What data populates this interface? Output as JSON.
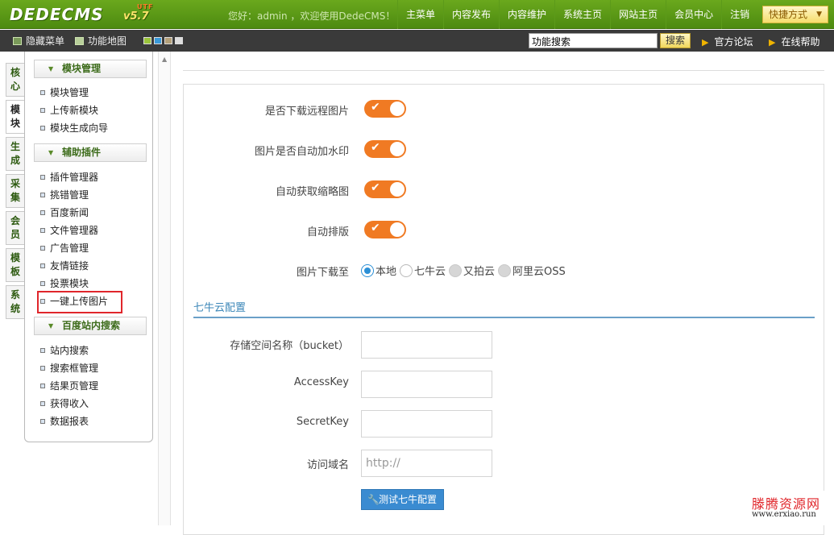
{
  "header": {
    "logo": "DEDECMS",
    "version": "v5.7",
    "charset": "UTF",
    "greeting": "您好：admin ，欢迎使用DedeCMS！",
    "nav": [
      "主菜单",
      "内容发布",
      "内容维护",
      "系统主页",
      "网站主页",
      "会员中心",
      "注销"
    ],
    "quick_menu": "快捷方式",
    "colors": {
      "bar": "#5a9a17",
      "subbar": "#3a3a3a"
    }
  },
  "subbar": {
    "hide_menu": "隐藏菜单",
    "feature_map": "功能地图",
    "skin_colors": [
      "#9ac43c",
      "#3a9ad9",
      "#b3a07a",
      "#dddddd"
    ],
    "search_value": "功能搜索",
    "search_button": "搜索",
    "forum": "官方论坛",
    "help": "在线帮助"
  },
  "vtabs": [
    {
      "label": "核心",
      "active": false
    },
    {
      "label": "模块",
      "active": true
    },
    {
      "label": "生成",
      "active": false
    },
    {
      "label": "采集",
      "active": false
    },
    {
      "label": "会员",
      "active": false
    },
    {
      "label": "模板",
      "active": false
    },
    {
      "label": "系统",
      "active": false
    }
  ],
  "sidebar": {
    "groups": [
      {
        "title": "模块管理",
        "items": [
          "模块管理",
          "上传新模块",
          "模块生成向导"
        ]
      },
      {
        "title": "辅助插件",
        "items": [
          "插件管理器",
          "挑错管理",
          "百度新闻",
          "文件管理器",
          "广告管理",
          "友情链接",
          "投票模块",
          "一键上传图片"
        ]
      },
      {
        "title": "百度站内搜索",
        "items": [
          "站内搜索",
          "搜索框管理",
          "结果页管理",
          "获得收入",
          "数据报表"
        ]
      }
    ],
    "highlighted_item": "一键上传图片"
  },
  "form": {
    "toggles": [
      {
        "label": "是否下载远程图片",
        "on": true
      },
      {
        "label": "图片是否自动加水印",
        "on": true
      },
      {
        "label": "自动获取缩略图",
        "on": true
      },
      {
        "label": "自动排版",
        "on": true
      }
    ],
    "download_to": {
      "label": "图片下载至",
      "options": [
        {
          "label": "本地",
          "checked": true,
          "disabled": false
        },
        {
          "label": "七牛云",
          "checked": false,
          "disabled": false
        },
        {
          "label": "又拍云",
          "checked": false,
          "disabled": true
        },
        {
          "label": "阿里云OSS",
          "checked": false,
          "disabled": true
        }
      ]
    },
    "section_title": "七牛云配置",
    "fields": [
      {
        "label": "存储空间名称（bucket）",
        "value": "",
        "placeholder": ""
      },
      {
        "label": "AccessKey",
        "value": "",
        "placeholder": ""
      },
      {
        "label": "SecretKey",
        "value": "",
        "placeholder": ""
      },
      {
        "label": "访问域名",
        "value": "",
        "placeholder": "http://"
      }
    ],
    "test_button": "测试七牛配置",
    "accent": "#f07a23"
  },
  "watermark": {
    "text": "滕腾资源网",
    "url": "www.erxiao.run"
  }
}
